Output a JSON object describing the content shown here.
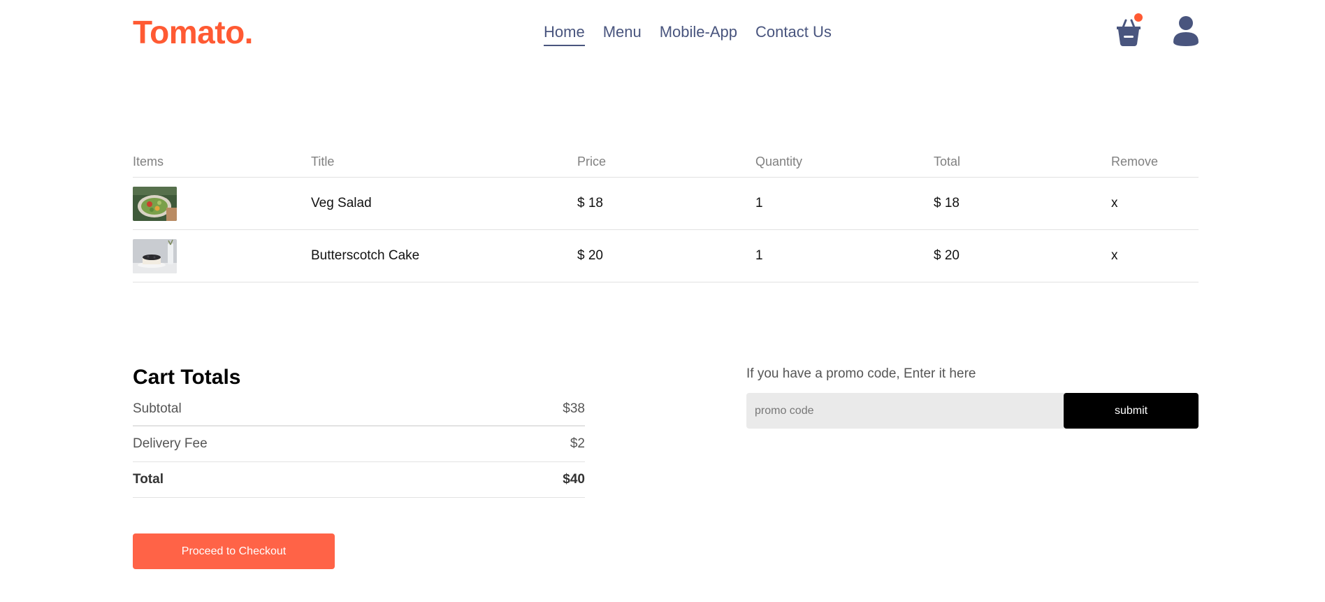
{
  "navbar": {
    "logo": "Tomato.",
    "links": [
      "Home",
      "Menu",
      "Mobile-App",
      "Contact Us"
    ],
    "active_link": "Home",
    "basket_icon": "basket-icon",
    "profile_icon": "profile-icon",
    "accent_color": "#ff5a33"
  },
  "cart": {
    "headers": [
      "Items",
      "Title",
      "Price",
      "Quantity",
      "Total",
      "Remove"
    ],
    "items": [
      {
        "image": "veg-salad-image",
        "title": "Veg Salad",
        "price": "$ 18",
        "quantity": "1",
        "total": "$ 18",
        "remove": "x"
      },
      {
        "image": "butterscotch-cake-image",
        "title": "Butterscotch Cake",
        "price": "$ 20",
        "quantity": "1",
        "total": "$ 20",
        "remove": "x"
      }
    ]
  },
  "totals": {
    "title": "Cart Totals",
    "subtotal_label": "Subtotal",
    "subtotal_value": "$38",
    "delivery_label": "Delivery Fee",
    "delivery_value": "$2",
    "total_label": "Total",
    "total_value": "$40",
    "checkout_label": "Proceed to Checkout",
    "checkout_color": "#ff6347"
  },
  "promo": {
    "text": "If you have a promo code, Enter it here",
    "placeholder": "promo code",
    "value": "",
    "submit_label": "submit"
  }
}
